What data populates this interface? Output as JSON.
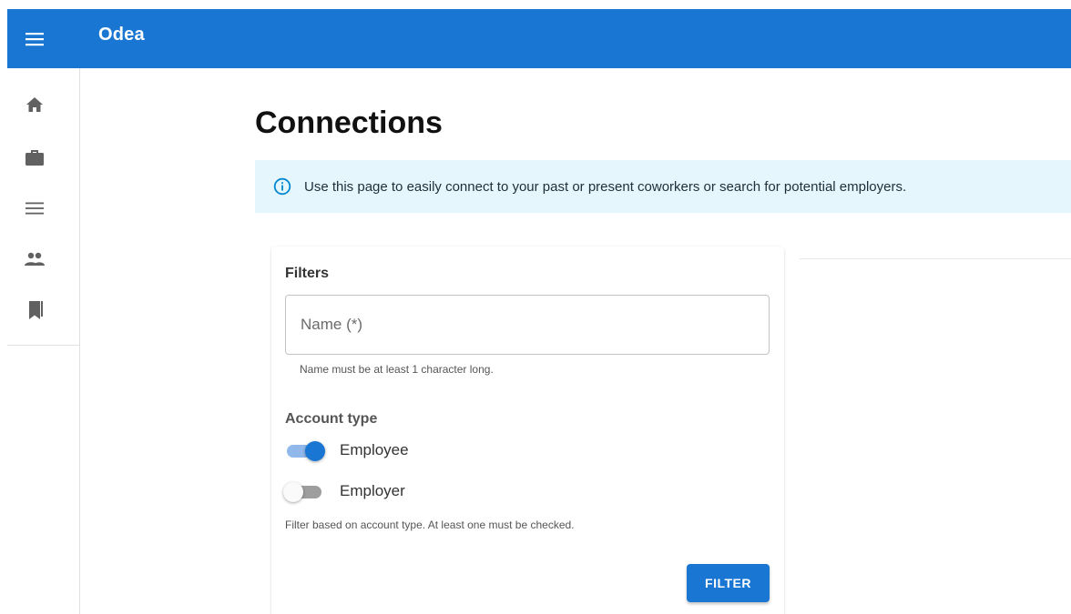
{
  "appbar": {
    "title": "Odea",
    "menu_icon": "hamburger-menu-icon"
  },
  "nav_rail": {
    "items": [
      {
        "icon": "home-icon"
      },
      {
        "icon": "briefcase-icon"
      },
      {
        "icon": "list-icon"
      },
      {
        "icon": "people-icon"
      },
      {
        "icon": "bookmarks-icon"
      }
    ]
  },
  "page": {
    "title": "Connections",
    "info": "Use this page to easily connect to your past or present coworkers or search for potential employers."
  },
  "filters": {
    "title": "Filters",
    "name_placeholder": "Name (*)",
    "name_value": "",
    "name_helper": "Name must be at least 1 character long.",
    "account_type_title": "Account type",
    "options": [
      {
        "label": "Employee",
        "checked": true
      },
      {
        "label": "Employer",
        "checked": false
      }
    ],
    "account_helper": "Filter based on account type. At least one must be checked.",
    "button": "FILTER"
  },
  "colors": {
    "primary": "#1976d2",
    "info_bg": "#e5f6fd"
  }
}
